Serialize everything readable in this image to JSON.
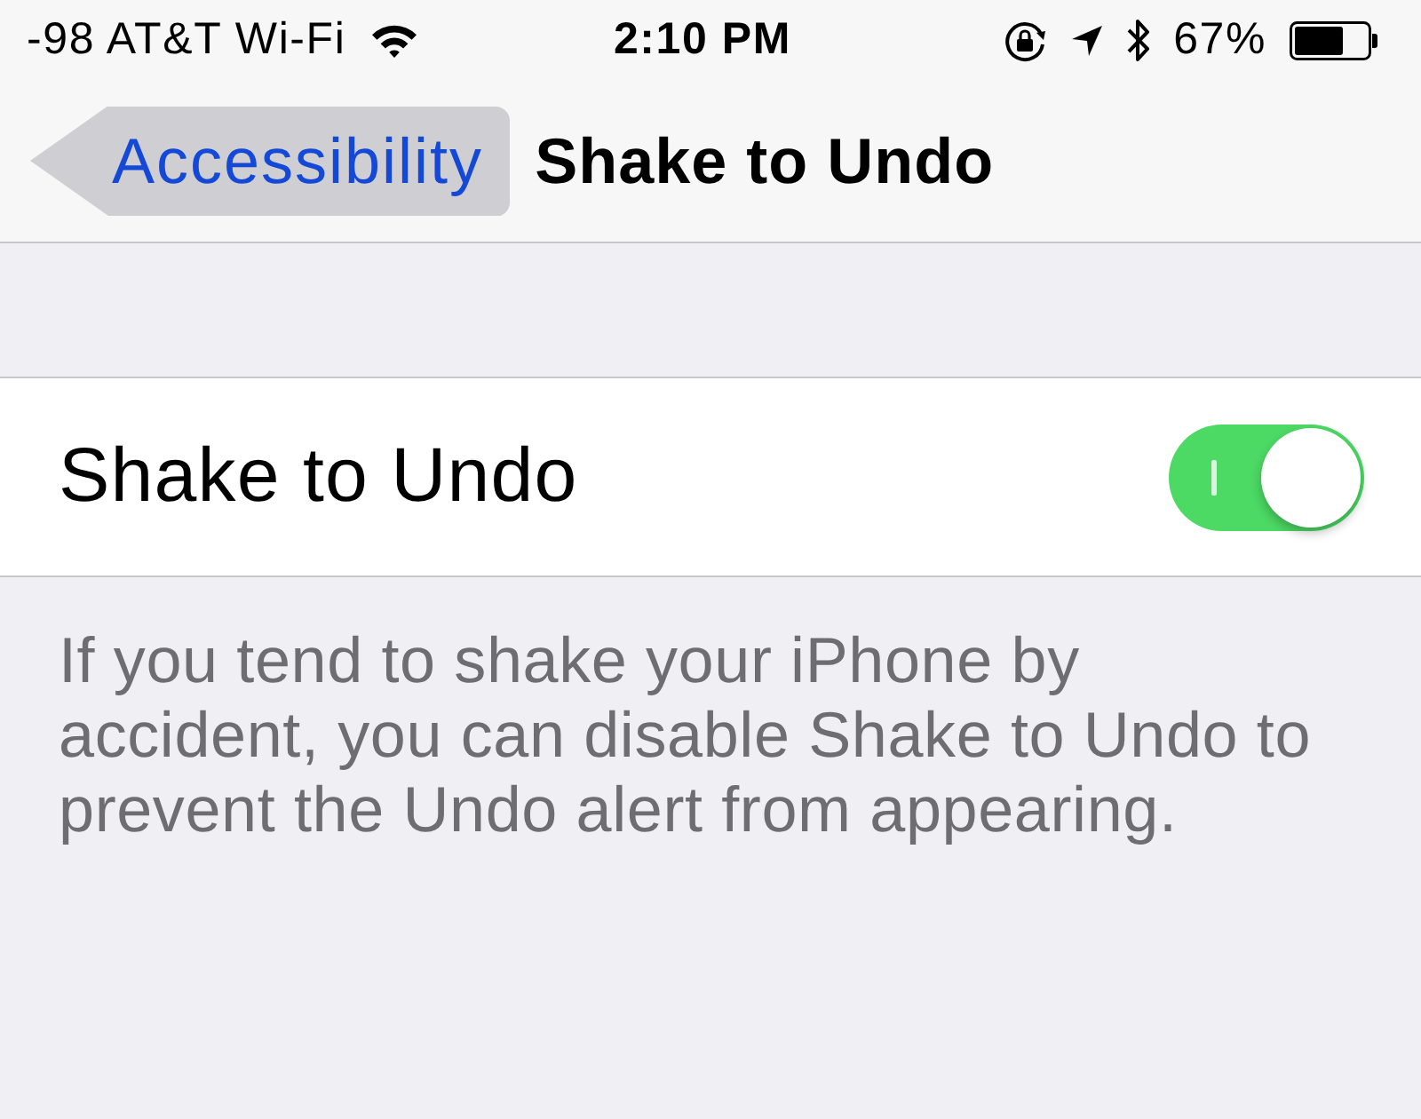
{
  "status_bar": {
    "carrier": "-98 AT&T Wi-Fi",
    "time": "2:10 PM",
    "battery": "67%"
  },
  "nav_bar": {
    "back_button": {
      "label": "Accessibility",
      "pressed": true
    },
    "title": "Shake to Undo"
  },
  "settings": [
    {
      "label": "Shake to Undo",
      "on": true
    }
  ],
  "footer": "If you tend to shake your iPhone by accident, you can disable Shake to Undo to prevent the Undo alert from appearing."
}
